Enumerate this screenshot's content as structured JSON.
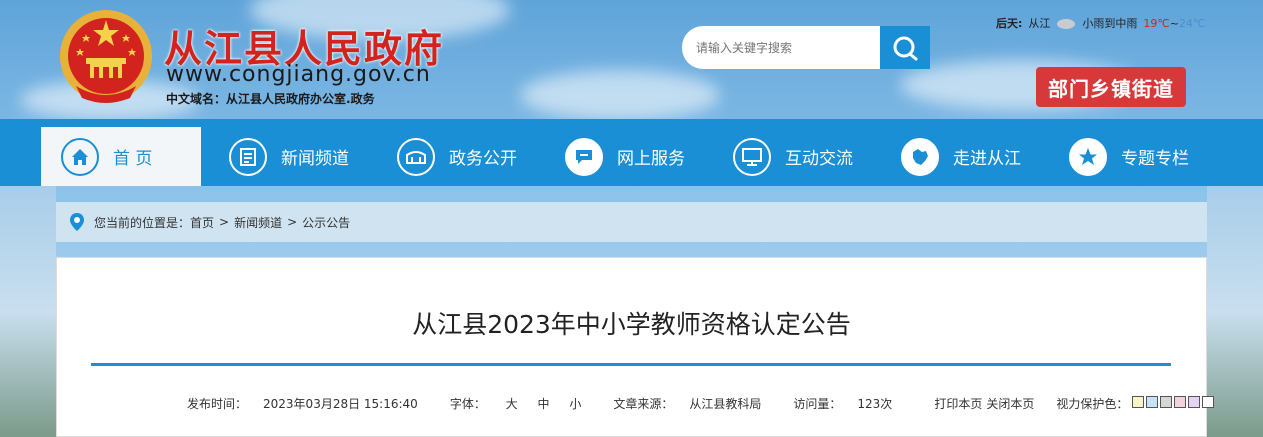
{
  "header": {
    "site_title": "从江县人民政府",
    "site_url": "www.congjiang.gov.cn",
    "domain_label": "中文域名：",
    "domain_value": "从江县人民政府办公室.政务",
    "search_placeholder": "请输入关键字搜索",
    "weather": {
      "label": "后天:",
      "city": "从江",
      "condition": "小雨到中雨",
      "high": "19℃",
      "sep": "~",
      "low": "24℃"
    },
    "dept_button": "部门乡镇街道"
  },
  "nav": {
    "items": [
      {
        "label": "首 页",
        "icon": "home-icon"
      },
      {
        "label": "新闻频道",
        "icon": "news-icon"
      },
      {
        "label": "政务公开",
        "icon": "gov-icon"
      },
      {
        "label": "网上服务",
        "icon": "chat-icon"
      },
      {
        "label": "互动交流",
        "icon": "monitor-icon"
      },
      {
        "label": "走进从江",
        "icon": "map-icon"
      },
      {
        "label": "专题专栏",
        "icon": "star-icon"
      }
    ]
  },
  "breadcrumb": {
    "prefix": "您当前的位置是：",
    "items": [
      "首页",
      "新闻频道",
      "公示公告"
    ],
    "sep": ">"
  },
  "article": {
    "title": "从江县2023年中小学教师资格认定公告",
    "publish_label": "发布时间：",
    "publish_time": "2023年03月28日 15:16:40",
    "font_label": "字体：",
    "font_options": [
      "大",
      "中",
      "小"
    ],
    "source_label": "文章来源：",
    "source": "从江县教科局",
    "views_label": "访问量：",
    "views": "123次",
    "print": "打印本页",
    "close": "关闭本页",
    "eye_label": "视力保护色：",
    "eye_colors": [
      "#fbf4c8",
      "#c4e3f5",
      "#d6d6d6",
      "#f4d2dc",
      "#e6d3f3",
      "#ffffff"
    ]
  },
  "colors": {
    "brand_blue": "#1a8fd6",
    "brand_red": "#d2231f"
  }
}
